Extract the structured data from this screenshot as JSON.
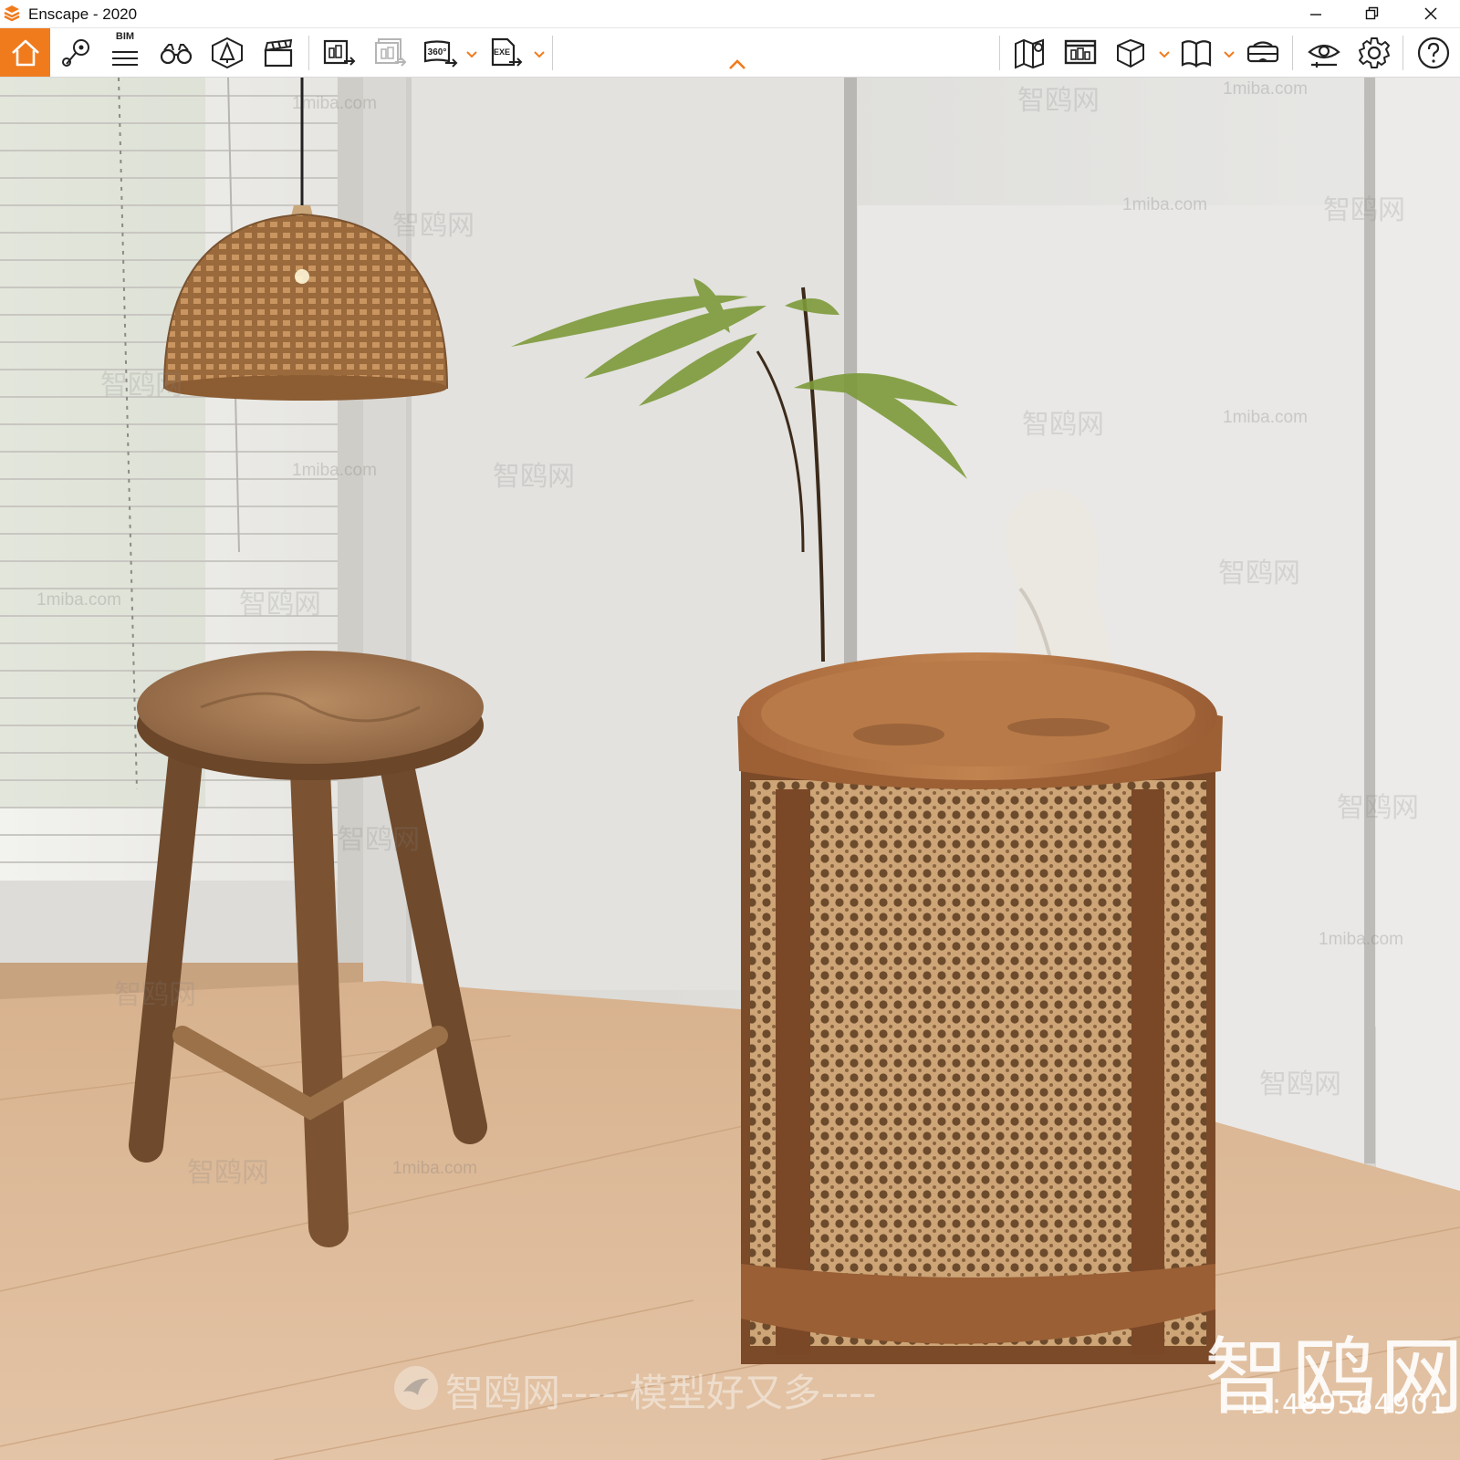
{
  "window": {
    "title": "Enscape - 2020",
    "controls": [
      "minimize",
      "restore",
      "close"
    ]
  },
  "toolbar": {
    "left_icons": [
      "home-icon",
      "views-icon",
      "bim-icon",
      "walk-mode-icon",
      "asset-library-icon",
      "video-editor-icon"
    ],
    "bim_label": "BIM",
    "export_icons": [
      "screenshot-export-icon",
      "batch-render-icon",
      "panorama-360-icon",
      "exe-export-icon"
    ],
    "panorama_label": "360°",
    "exe_label": "EXE",
    "right_icons": [
      "map-view-icon",
      "web-standalone-icon",
      "cube-view-icon",
      "book-icon",
      "vr-headset-icon",
      "visual-settings-icon",
      "general-settings-icon",
      "help-icon"
    ],
    "accent_color": "#f07b1d"
  },
  "viewport": {
    "watermarks": {
      "site_small": "1miba.com",
      "brand_cn": "智鸥网",
      "slogan": "智鸥网-----模型好又多----",
      "big_brand": "智鸥网",
      "id_text": "ID:489564901"
    }
  }
}
